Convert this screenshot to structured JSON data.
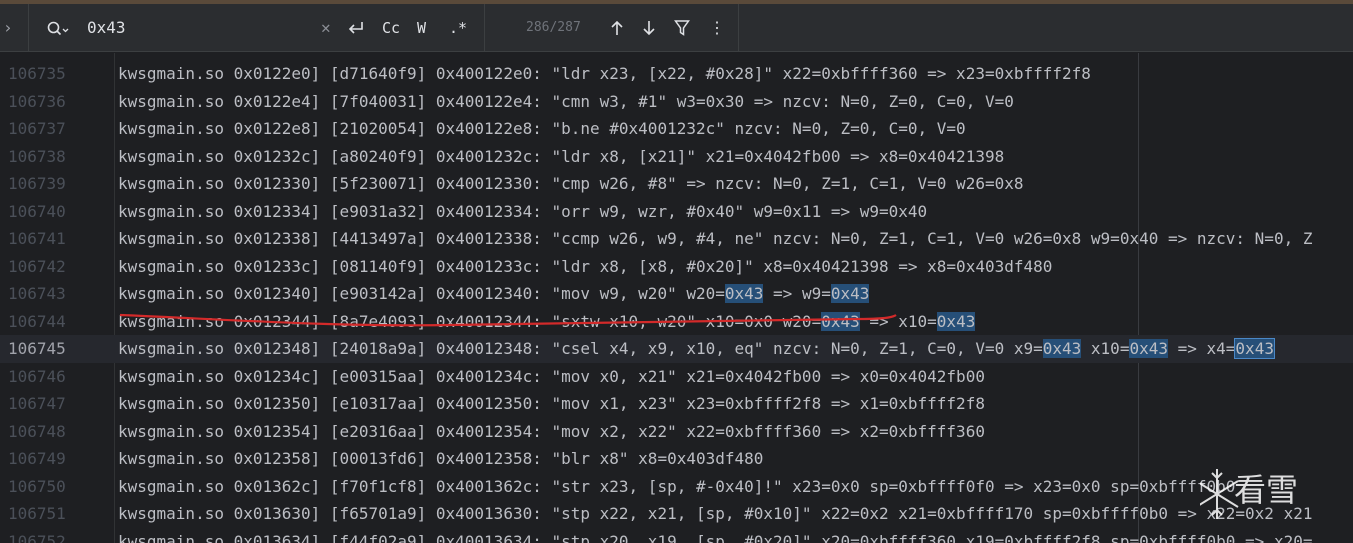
{
  "find": {
    "query": "0x43",
    "match_counter": "286/287",
    "case_label": "Cc",
    "word_label": "W",
    "regex_label": ".*"
  },
  "lines": [
    {
      "num": "106735",
      "text": "kwsgmain.so 0x0122e0] [d71640f9] 0x400122e0: \"ldr x23, [x22, #0x28]\" x22=0xbffff360 => x23=0xbffff2f8"
    },
    {
      "num": "106736",
      "text": "kwsgmain.so 0x0122e4] [7f040031] 0x400122e4: \"cmn w3, #1\" w3=0x30 => nzcv: N=0, Z=0, C=0, V=0"
    },
    {
      "num": "106737",
      "text": "kwsgmain.so 0x0122e8] [21020054] 0x400122e8: \"b.ne #0x4001232c\" nzcv: N=0, Z=0, C=0, V=0"
    },
    {
      "num": "106738",
      "text": "kwsgmain.so 0x01232c] [a80240f9] 0x4001232c: \"ldr x8, [x21]\" x21=0x4042fb00 => x8=0x40421398"
    },
    {
      "num": "106739",
      "text": "kwsgmain.so 0x012330] [5f230071] 0x40012330: \"cmp w26, #8\" => nzcv: N=0, Z=1, C=1, V=0 w26=0x8"
    },
    {
      "num": "106740",
      "text": "kwsgmain.so 0x012334] [e9031a32] 0x40012334: \"orr w9, wzr, #0x40\" w9=0x11 => w9=0x40"
    },
    {
      "num": "106741",
      "text": "kwsgmain.so 0x012338] [4413497a] 0x40012338: \"ccmp w26, w9, #4, ne\" nzcv: N=0, Z=1, C=1, V=0 w26=0x8 w9=0x40 => nzcv: N=0, Z"
    },
    {
      "num": "106742",
      "text": "kwsgmain.so 0x01233c] [081140f9] 0x4001233c: \"ldr x8, [x8, #0x20]\" x8=0x40421398 => x8=0x403df480"
    },
    {
      "num": "106743",
      "segments": [
        {
          "t": "kwsgmain.so 0x012340] [e903142a] 0x40012340: \"mov w9, w20\" w20="
        },
        {
          "t": "0x43",
          "hl": true
        },
        {
          "t": " => w9="
        },
        {
          "t": "0x43",
          "hl": true
        }
      ]
    },
    {
      "num": "106744",
      "segments": [
        {
          "t": "kwsgmain.so 0x012344] [8a7e4093] 0x40012344: \"sxtw x10, w20\" x10=0x0 w20="
        },
        {
          "t": "0x43",
          "hl": true
        },
        {
          "t": " => x10="
        },
        {
          "t": "0x43",
          "hl": true
        }
      ]
    },
    {
      "num": "106745",
      "current": true,
      "segments": [
        {
          "t": "kwsgmain.so 0x012348] [24018a9a] 0x40012348: \"csel x4, x9, x10, eq\" nzcv: N=0, Z=1, C=0, V=0 x9="
        },
        {
          "t": "0x43",
          "hl": true
        },
        {
          "t": " x10="
        },
        {
          "t": "0x43",
          "hl": true
        },
        {
          "t": " => x4="
        },
        {
          "t": "0x43",
          "hl": "sel"
        }
      ]
    },
    {
      "num": "106746",
      "text": "kwsgmain.so 0x01234c] [e00315aa] 0x4001234c: \"mov x0, x21\" x21=0x4042fb00 => x0=0x4042fb00"
    },
    {
      "num": "106747",
      "text": "kwsgmain.so 0x012350] [e10317aa] 0x40012350: \"mov x1, x23\" x23=0xbffff2f8 => x1=0xbffff2f8"
    },
    {
      "num": "106748",
      "text": "kwsgmain.so 0x012354] [e20316aa] 0x40012354: \"mov x2, x22\" x22=0xbffff360 => x2=0xbffff360"
    },
    {
      "num": "106749",
      "text": "kwsgmain.so 0x012358] [00013fd6] 0x40012358: \"blr x8\" x8=0x403df480"
    },
    {
      "num": "106750",
      "text": "kwsgmain.so 0x01362c] [f70f1cf8] 0x4001362c: \"str x23, [sp, #-0x40]!\" x23=0x0 sp=0xbffff0f0 => x23=0x0 sp=0xbffff0b0"
    },
    {
      "num": "106751",
      "text": "kwsgmain.so 0x013630] [f65701a9] 0x40013630: \"stp x22, x21, [sp, #0x10]\" x22=0x2 x21=0xbffff170 sp=0xbffff0b0 => x22=0x2 x21"
    },
    {
      "num": "106752",
      "text": "kwsgmain.so 0x013634] [f44f02a9] 0x40013634: \"stp x20, x19, [sp, #0x20]\" x20=0xbffff360 x19=0xbffff2f8 sp=0xbffff0b0 => x20="
    }
  ],
  "watermark": {
    "text": "看雪"
  }
}
